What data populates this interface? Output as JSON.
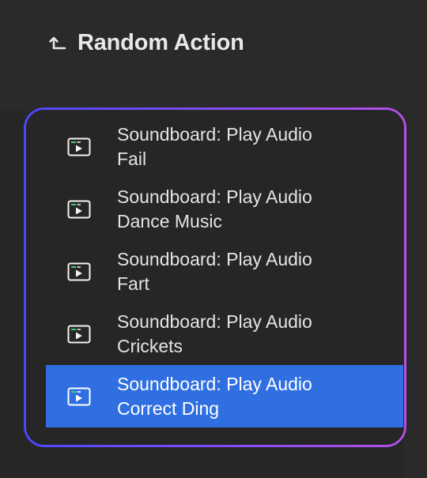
{
  "header": {
    "icon": "return-up-arrow-icon",
    "title": "Random Action"
  },
  "list": {
    "items": [
      {
        "line1": "Soundboard: Play Audio",
        "line2": "Fail",
        "icon": "play-window-icon",
        "selected": false
      },
      {
        "line1": "Soundboard: Play Audio",
        "line2": "Dance Music",
        "icon": "play-window-icon",
        "selected": false
      },
      {
        "line1": "Soundboard: Play Audio",
        "line2": "Fart",
        "icon": "play-window-icon",
        "selected": false
      },
      {
        "line1": "Soundboard: Play Audio",
        "line2": "Crickets",
        "icon": "play-window-icon",
        "selected": false
      },
      {
        "line1": "Soundboard: Play Audio",
        "line2": "Correct Ding",
        "icon": "play-window-icon",
        "selected": true
      }
    ]
  },
  "colors": {
    "background": "#2a2a2a",
    "selection": "#2f6fe1",
    "frame_start": "#4c47ff",
    "frame_end": "#b64fe6",
    "icon_accent": "#3ecf6a"
  }
}
